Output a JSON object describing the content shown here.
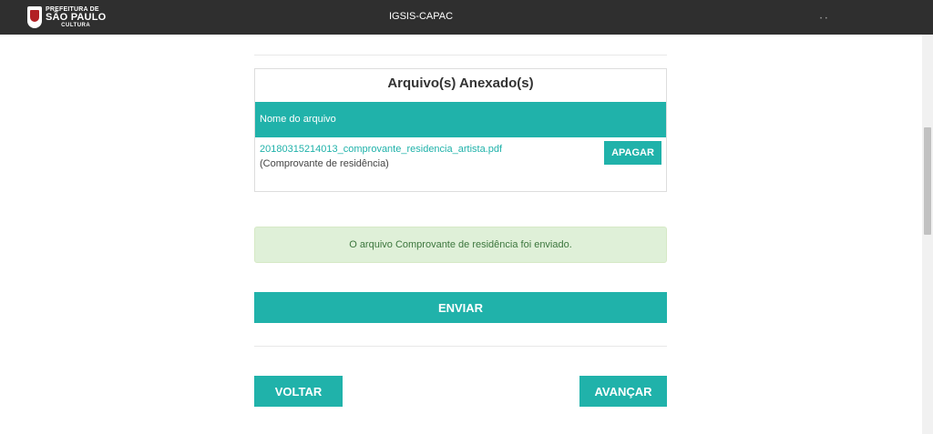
{
  "header": {
    "logo": {
      "line1": "PREFEITURA DE",
      "line2": "SÃO PAULO",
      "line3": "CULTURA"
    },
    "app_title": "IGSIS-CAPAC"
  },
  "attachments": {
    "title": "Arquivo(s) Anexado(s)",
    "column_header": "Nome do arquivo",
    "files": [
      {
        "name": "20180315214013_comprovante_residencia_artista.pdf",
        "description": "(Comprovante de residência)",
        "delete_label": "APAGAR"
      }
    ]
  },
  "alert": {
    "message": "O arquivo Comprovante de residência foi enviado."
  },
  "actions": {
    "submit_label": "ENVIAR",
    "back_label": "VOLTAR",
    "next_label": "AVANÇAR"
  },
  "colors": {
    "accent": "#20b2aa",
    "topbar": "#2f2f2f",
    "alert_bg": "#dff0d8",
    "alert_text": "#3c763d"
  }
}
